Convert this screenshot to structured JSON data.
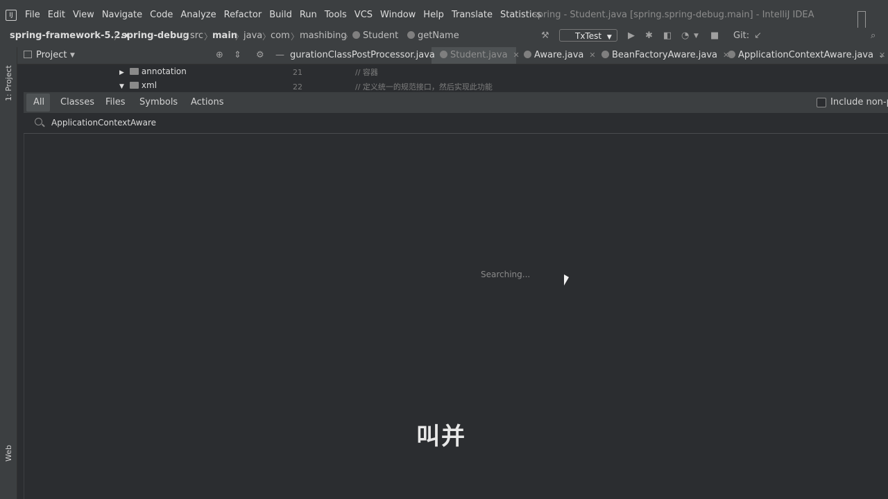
{
  "menu": {
    "items": [
      "File",
      "Edit",
      "View",
      "Navigate",
      "Code",
      "Analyze",
      "Refactor",
      "Build",
      "Run",
      "Tools",
      "VCS",
      "Window",
      "Help",
      "Translate",
      "Statistics"
    ],
    "window_title": "spring - Student.java [spring.spring-debug.main] - IntelliJ IDEA"
  },
  "breadcrumb": [
    "spring-framework-5.2.x",
    "spring-debug",
    "src",
    "main",
    "java",
    "com",
    "mashibing",
    "Student",
    "getName"
  ],
  "toolbar": {
    "run_config": "TxTest",
    "git_label": "Git:"
  },
  "project_panel": {
    "label": "Project"
  },
  "editor_tabs": [
    "gurationClassPostProcessor.java",
    "Student.java",
    "Aware.java",
    "BeanFactoryAware.java",
    "ApplicationContextAware.java"
  ],
  "tree": [
    {
      "label": "annotation",
      "arrow": "▶"
    },
    {
      "label": "xml",
      "arrow": "▼"
    }
  ],
  "code_peek": [
    {
      "line": "21",
      "text": "//  容器"
    },
    {
      "line": "22",
      "text": "//  定义统一的规范接口，然后实现此功能"
    }
  ],
  "left_strip": {
    "project": "1: Project",
    "web": "Web"
  },
  "search_popup": {
    "tabs": [
      "All",
      "Classes",
      "Files",
      "Symbols",
      "Actions"
    ],
    "include_label": "Include non-pr",
    "query": "ApplicationContextAware",
    "status": "Searching..."
  },
  "subtitle": "叫并"
}
